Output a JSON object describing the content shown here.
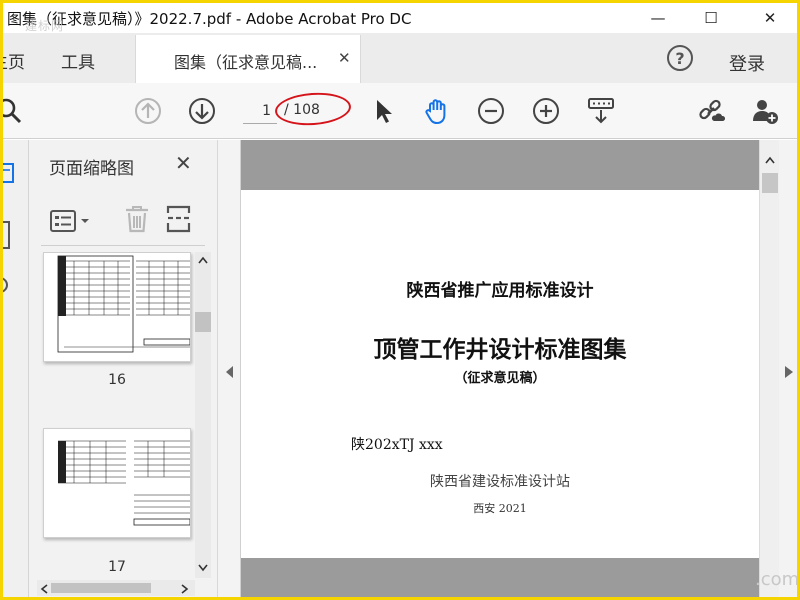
{
  "window": {
    "title": "图集（征求意见稿）》2022.7.pdf - Adobe Acrobat Pro DC",
    "title_watermark": "建标网",
    "minimize_glyph": "—",
    "maximize_glyph": "☐",
    "close_glyph": "✕"
  },
  "nav": {
    "home_label": "主页",
    "tools_label": "工具",
    "tab_label": "图集（征求意见稿...",
    "tab_close": "✕",
    "help_glyph": "?",
    "login_label": "登录"
  },
  "toolbar": {
    "current_page": "1",
    "page_total": "/ 108",
    "icons": [
      "search-icon",
      "page-up-icon",
      "page-down-icon",
      "select-arrow-icon",
      "hand-tool-icon",
      "zoom-out-icon",
      "zoom-in-icon",
      "keyboard-scroll-icon",
      "share-link-icon",
      "add-user-icon"
    ],
    "annotation_color": "#d4141a"
  },
  "thumbnails": {
    "title": "页面缩略图",
    "close_glyph": "✕",
    "items": [
      {
        "label": "16"
      },
      {
        "label": "17"
      }
    ]
  },
  "document": {
    "org_title": "陕西省推广应用标准设计",
    "main_title": "顶管工作井设计标准图集",
    "subtitle": "（征求意见稿）",
    "code": "陕202xTJ xxx",
    "publisher": "陕西省建设标准设计站",
    "place_year": "西安 2021"
  },
  "watermark_bottom": ".com",
  "colors": {
    "frame_border": "#f5d400",
    "accent_blue": "#1473e6",
    "doc_bg": "#9b9b9b"
  }
}
